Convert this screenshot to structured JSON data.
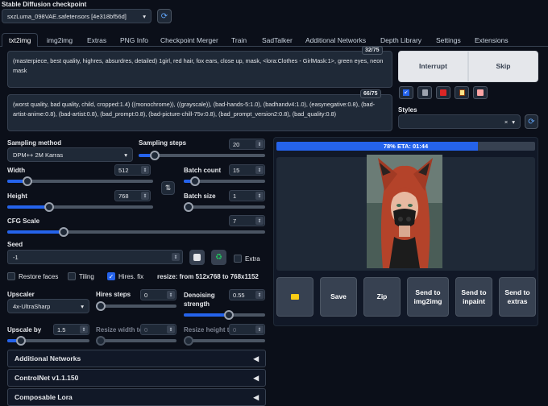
{
  "checkpoint": {
    "label": "Stable Diffusion checkpoint",
    "value": "sxzLuma_098VAE.safetensors [4e318bf56d]",
    "refresh_icon": "refresh-icon"
  },
  "tabs": [
    "txt2img",
    "img2img",
    "Extras",
    "PNG Info",
    "Checkpoint Merger",
    "Train",
    "SadTalker",
    "Additional Networks",
    "Depth Library",
    "Settings",
    "Extensions"
  ],
  "prompt": {
    "text": "(masterpiece, best quality, highres, absurdres, detailed) 1girl, red hair, fox ears, close up, mask,  <lora:Clothes - GirlMask:1>, green eyes, neon mask",
    "tokens": "32/75"
  },
  "negative_prompt": {
    "text": "(worst quality, bad quality, child, cropped:1.4) ((monochrome)), ((grayscale)), (bad-hands-5:1.0), (badhandv4:1.0), (easynegative:0.8), (bad-artist-anime:0.8), (bad-artist:0.8), (bad_prompt:0.8), (bad-picture-chill-75v:0.8), (bad_prompt_version2:0.8), (bad_quality:0.8)",
    "tokens": "66/75"
  },
  "actions": {
    "interrupt": "Interrupt",
    "skip": "Skip"
  },
  "styles": {
    "label": "Styles",
    "clear": "×",
    "dropdown": "▾"
  },
  "sampling": {
    "method_label": "Sampling method",
    "method_value": "DPM++ 2M Karras",
    "steps_label": "Sampling steps",
    "steps_value": "20",
    "steps_fraction": 0.13
  },
  "width": {
    "label": "Width",
    "value": "512",
    "fraction": 0.14
  },
  "height": {
    "label": "Height",
    "value": "768",
    "fraction": 0.29
  },
  "batch_count": {
    "label": "Batch count",
    "value": "15",
    "fraction": 0.14
  },
  "batch_size": {
    "label": "Batch size",
    "value": "1",
    "fraction": 0.0
  },
  "cfg": {
    "label": "CFG Scale",
    "value": "7",
    "fraction": 0.22
  },
  "seed": {
    "label": "Seed",
    "value": "-1",
    "extra": "Extra"
  },
  "options": {
    "restore_faces": "Restore faces",
    "tiling": "Tiling",
    "hires_fix": "Hires. fix",
    "hires_fix_checked": true,
    "resize_info": "resize: from 512x768 to 768x1152"
  },
  "upscaler": {
    "label": "Upscaler",
    "value": "4x-UltraSharp"
  },
  "hires_steps": {
    "label": "Hires steps",
    "value": "0",
    "fraction": 0.0
  },
  "denoising": {
    "label": "Denoising strength",
    "value": "0.55",
    "fraction": 0.55
  },
  "upscale_by": {
    "label": "Upscale by",
    "value": "1.5",
    "fraction": 0.17
  },
  "resize_width": {
    "label": "Resize width to",
    "value": "0"
  },
  "resize_height": {
    "label": "Resize height to",
    "value": "0"
  },
  "accordions": [
    "Additional Networks",
    "ControlNet v1.1.150",
    "Composable Lora"
  ],
  "progress": {
    "text": "78% ETA: 01:44",
    "fraction": 0.78
  },
  "output_buttons": {
    "folder": "📂",
    "save": "Save",
    "zip": "Zip",
    "img2img": "Send to img2img",
    "inpaint": "Send to inpaint",
    "extras": "Send to extras"
  },
  "colors": {
    "accent": "#2563eb",
    "background": "#0b0f19",
    "panel": "#1f2937"
  }
}
